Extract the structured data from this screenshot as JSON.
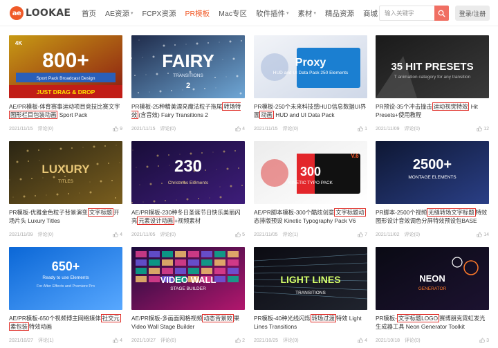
{
  "header": {
    "logo_badge": "ae",
    "logo_text": "LOOKAE",
    "nav": [
      {
        "label": "首页",
        "dropdown": false,
        "active": false
      },
      {
        "label": "AE资源",
        "dropdown": true,
        "active": false
      },
      {
        "label": "FCPX资源",
        "dropdown": false,
        "active": false
      },
      {
        "label": "PR模板",
        "dropdown": false,
        "active": true
      },
      {
        "label": "Mac专区",
        "dropdown": false,
        "active": false
      },
      {
        "label": "软件插件",
        "dropdown": true,
        "active": false
      },
      {
        "label": "素材",
        "dropdown": true,
        "active": false
      },
      {
        "label": "精品资源",
        "dropdown": false,
        "active": false
      },
      {
        "label": "商城",
        "dropdown": false,
        "active": false
      }
    ],
    "search_placeholder": "输入关键字",
    "login_label": "登录/注册",
    "accent_color": "#f05a28"
  },
  "cards": [
    {
      "title_pre": "AE/PR模板-体育赛事运动项目竞技比赛文字",
      "title_hl": "图形栏目包装动画",
      "title_post": " Sport Pack",
      "date": "2021/11/15",
      "comments": "评论(0)",
      "likes": "9",
      "thumb": {
        "big": "800+",
        "small": "Sport Pack Broadcast Design",
        "tag": "4K",
        "footer": "JUST DRAG & DROP"
      }
    },
    {
      "title_pre": "PR模板-25种精美漂亮魔法粒子拖尾",
      "title_hl": "转场特效",
      "title_post": "(含音效) Fairy Transitions 2",
      "date": "2021/11/15",
      "comments": "评论(0)",
      "likes": "4",
      "thumb": {
        "big": "FAIRY",
        "small": "TRANSITIONS",
        "tag": "2"
      }
    },
    {
      "title_pre": "PR模板-250个未来科技感HUD信息数据UI界面",
      "title_hl": "动画",
      "title_post": " HUD and UI Data Pack",
      "date": "2021/11/15",
      "comments": "评论(0)",
      "likes": "1",
      "thumb": {
        "big": "Proxy",
        "small": "HUD and UI Data Pack 250 Elements"
      }
    },
    {
      "title_pre": "PR预设-35个冲击撞击",
      "title_hl": "运动视觉特效",
      "title_post": " Hit Presets+使用教程",
      "date": "2021/11/09",
      "comments": "评论(0)",
      "likes": "12",
      "thumb": {
        "big": "35 HIT PRESETS",
        "small": "T animation category for any transition"
      }
    },
    {
      "title_pre": "PR模板-优雅金色粒子背景演变",
      "title_hl": "文字标题",
      "title_post": "开场片头 Luxury Titles",
      "date": "2021/11/09",
      "comments": "评论(0)",
      "likes": "4",
      "thumb": {
        "big": "LUXURY",
        "small": "TITLES"
      }
    },
    {
      "title_pre": "AE/PR模板-230种冬日圣诞节日快乐美丽闪亮",
      "title_hl": "元素设计动画",
      "title_post": "+视频素材",
      "date": "2021/11/05",
      "comments": "评论(0)",
      "likes": "5",
      "thumb": {
        "big": "230",
        "small": "Christmas Elements"
      }
    },
    {
      "title_pre": "AE/PR脚本模板-300个酷炫创意",
      "title_hl": "文字标题动",
      "title_post": "态排版预设 Kinetic Typography Pack V6",
      "date": "2021/11/05",
      "comments": "评论(1)",
      "likes": "7",
      "thumb": {
        "big": "300",
        "small": "KINETIC TYPO PACK",
        "tag": "V.6"
      }
    },
    {
      "title_pre": "PR脚本-2500个视频",
      "title_hl": "无缝转场文字标题",
      "title_post": "特效图形设计音效调色分屏特效预设包BASE V2.1",
      "date": "2021/11/02",
      "comments": "评论(0)",
      "likes": "14",
      "thumb": {
        "big": "2500+",
        "small": "MONTAGE ELEMENTS"
      }
    },
    {
      "title_pre": "AE/PR模板-650个视频博主网络媒体",
      "title_hl": "社交元",
      "title_post": "",
      "title_hl2": "素包装",
      "title_post2": "特效动画",
      "date": "2021/10/27",
      "comments": "评论(1)",
      "likes": "4",
      "thumb": {
        "big": "650+",
        "small": "Ready to use Elements",
        "sub": "For After Effects and Premiere Pro"
      }
    },
    {
      "title_pre": "AE/PR模板-多画面网格视频",
      "title_hl": "动态背景效",
      "title_post": "果 Video Wall Stage Builder",
      "date": "2021/10/27",
      "comments": "评论(0)",
      "likes": "2",
      "thumb": {
        "big": "VIDEO WALL",
        "small": "STAGE BUILDER"
      }
    },
    {
      "title_pre": "PR模板-40种光线闪烁",
      "title_hl": "转场过渡",
      "title_post": "特效 Light Lines Transitions",
      "date": "2021/10/25",
      "comments": "评论(0)",
      "likes": "4",
      "thumb": {
        "big": "LIGHT LINES",
        "small": "TRANSITIONS"
      }
    },
    {
      "title_pre": "PR模板-",
      "title_hl": "文字标题LOGO",
      "title_post": "赛博朋克霓虹发光生成器工具 Neon Generator Toolkit",
      "date": "2021/10/18",
      "comments": "评论(0)",
      "likes": "3",
      "thumb": {
        "big": "NEON",
        "small": "GENERATOR"
      }
    }
  ]
}
